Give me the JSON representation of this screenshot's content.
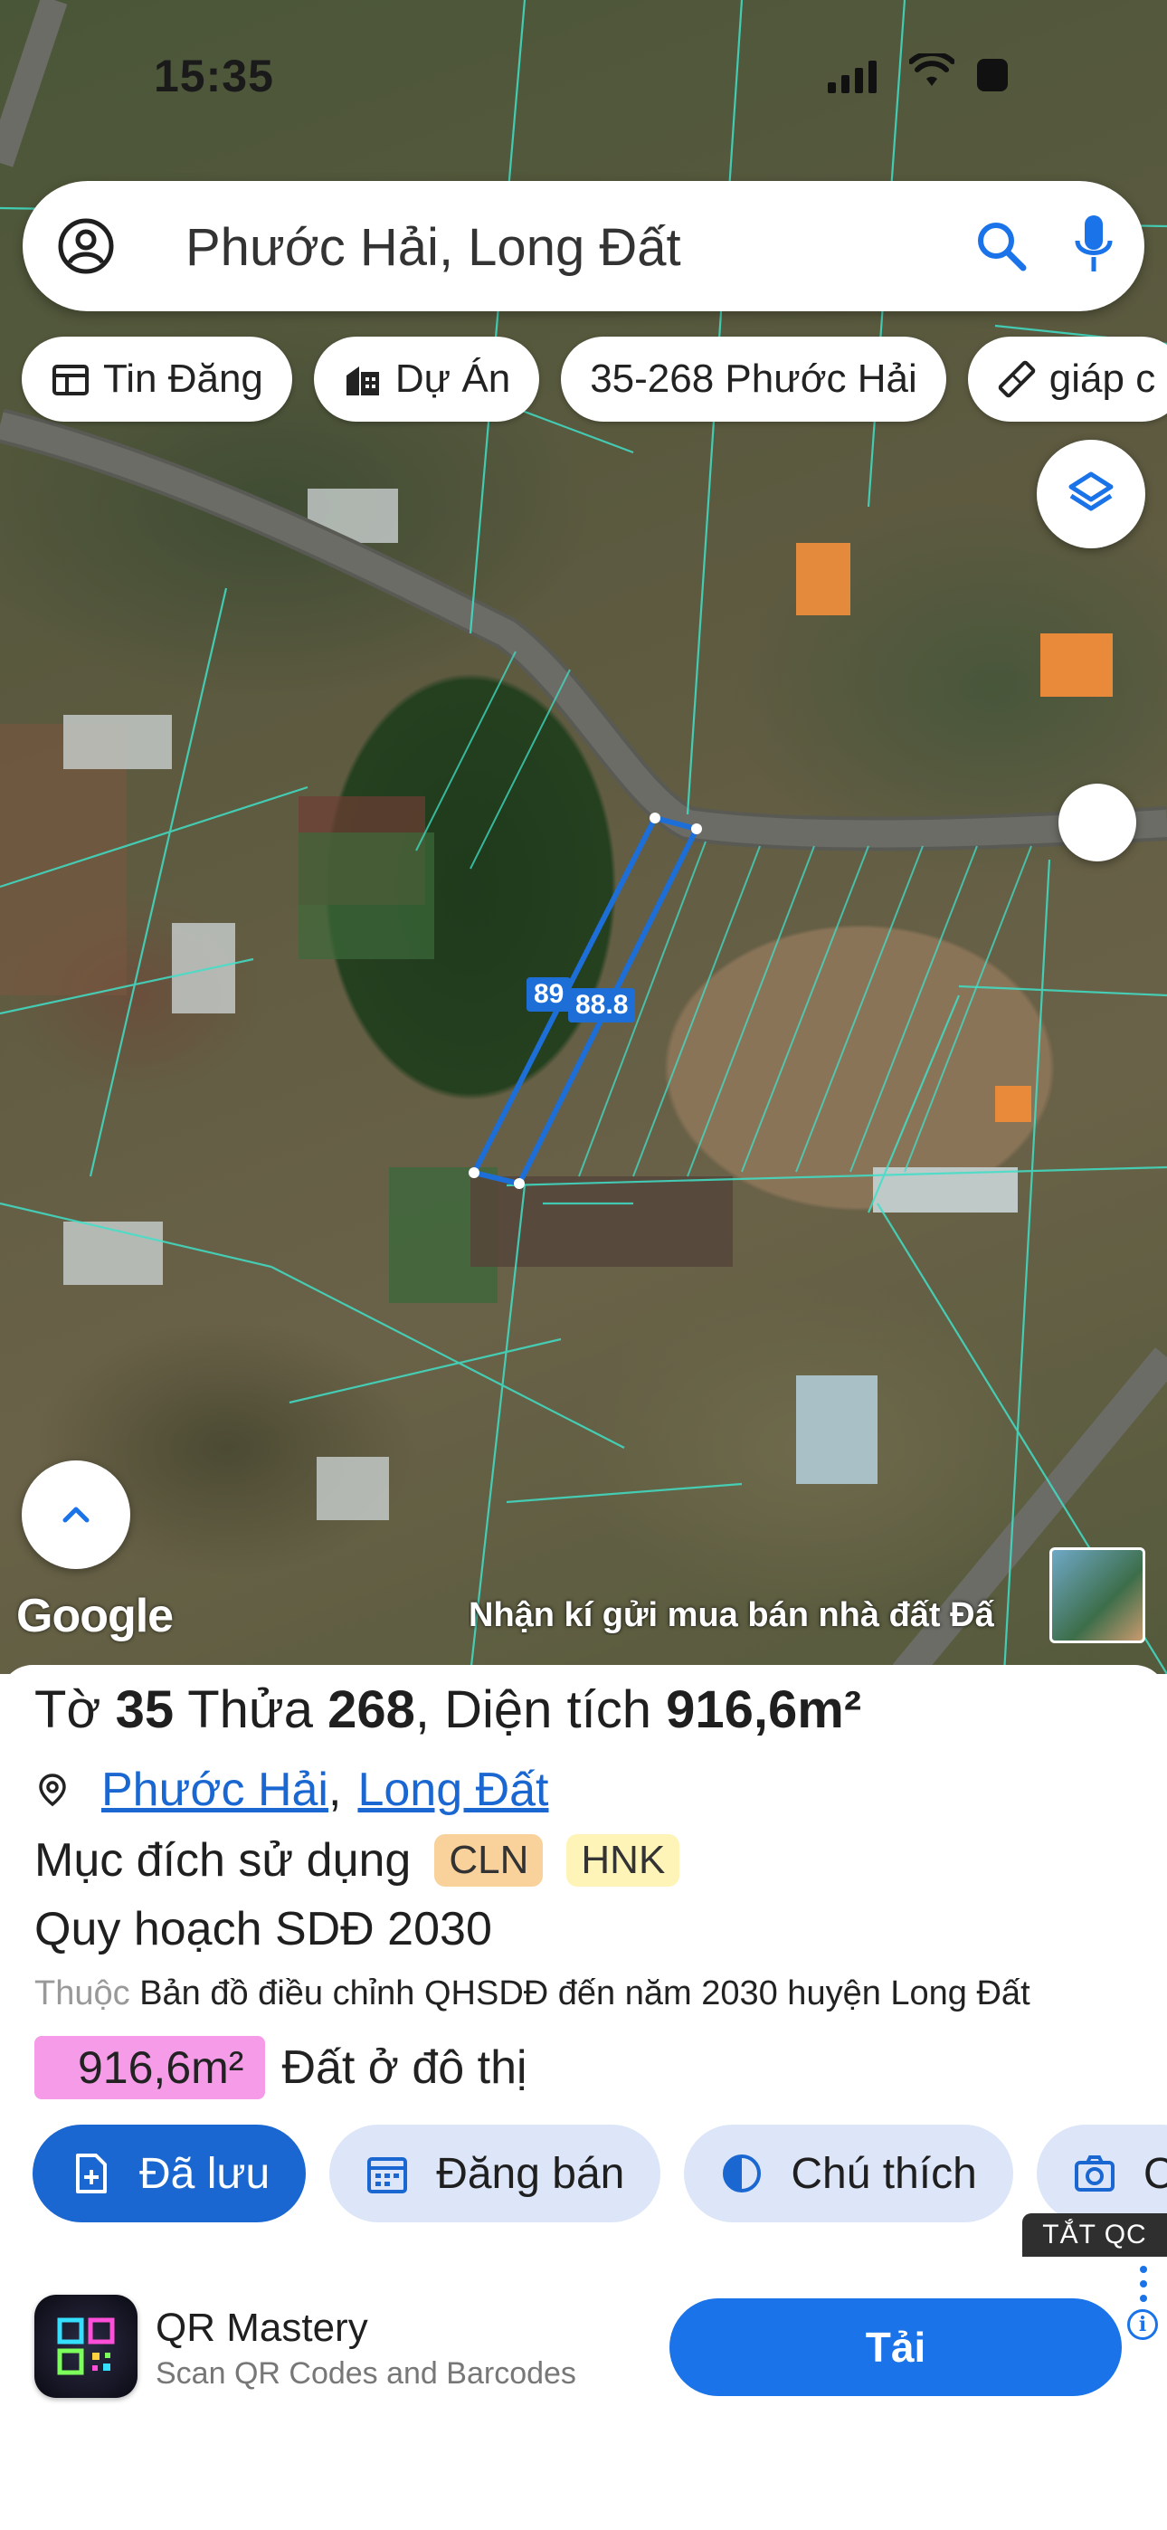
{
  "status_bar": {
    "time": "15:35"
  },
  "search": {
    "query": "Phước Hải, Long Đất"
  },
  "chips": [
    {
      "label": "Tin Đăng",
      "icon": "newspaper-icon"
    },
    {
      "label": "Dự Án",
      "icon": "building-icon"
    },
    {
      "label": "35-268 Phước Hải",
      "icon": ""
    },
    {
      "label": "giáp c",
      "icon": "ruler-icon"
    }
  ],
  "map": {
    "parcel_labels": [
      "89",
      "88.8"
    ],
    "attribution": "Google",
    "ad_overlay_text": "Nhận kí gửi mua bán nhà đất Đấ",
    "parcel_color": "#1e6ed8"
  },
  "sheet": {
    "title_prefix": "Tờ",
    "sheet_no": "35",
    "title_mid": "Thửa",
    "plot_no": "268",
    "area_label": ", Diện tích",
    "area_value": "916,6m²",
    "ward": "Phước Hải",
    "separator": ",",
    "district": "Long Đất",
    "purpose_label": "Mục đích sử dụng",
    "purpose_tags": [
      "CLN",
      "HNK"
    ],
    "plan_label": "Quy hoạch SDĐ 2030",
    "belongs_muted": "Thuộc",
    "belongs_text": "Bản đồ điều chỉnh QHSDĐ đến năm 2030 huyện Long Đất",
    "area_chip": "916,6m²",
    "area_type": "Đất ở đô thị",
    "actions": [
      {
        "label": "Đã lưu",
        "icon": "document-add-icon"
      },
      {
        "label": "Đăng bán",
        "icon": "calendar-icon"
      },
      {
        "label": "Chú thích",
        "icon": "contrast-icon"
      },
      {
        "label": "C",
        "icon": "camera-icon"
      }
    ],
    "hide_ads": "TẮT QC"
  },
  "ad": {
    "app_name": "QR Mastery",
    "app_subtitle": "Scan QR Codes and Barcodes",
    "install_label": "Tải",
    "info_glyph": "i",
    "accent": "#1a73e8"
  }
}
